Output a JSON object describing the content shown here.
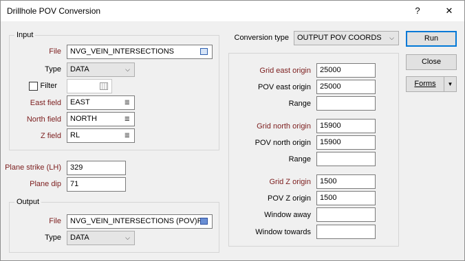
{
  "window": {
    "title": "Drillhole POV Conversion",
    "help_glyph": "?",
    "close_glyph": "✕"
  },
  "input": {
    "group_title": "Input",
    "file_label": "File",
    "file_value": "NVG_VEIN_INTERSECTIONS",
    "type_label": "Type",
    "type_value": "DATA",
    "filter_label": "Filter",
    "filter_value": "",
    "east_label": "East field",
    "east_value": "EAST",
    "north_label": "North field",
    "north_value": "NORTH",
    "z_label": "Z field",
    "z_value": "RL"
  },
  "plane": {
    "strike_label": "Plane strike (LH)",
    "strike_value": "329",
    "dip_label": "Plane dip",
    "dip_value": "71"
  },
  "output": {
    "group_title": "Output",
    "file_label": "File",
    "file_value": "NVG_VEIN_INTERSECTIONS (POV)P",
    "type_label": "Type",
    "type_value": "DATA"
  },
  "conversion": {
    "label": "Conversion type",
    "value": "OUTPUT POV COORDS",
    "grid_east_label": "Grid east origin",
    "grid_east_value": "25000",
    "pov_east_label": "POV east origin",
    "pov_east_value": "25000",
    "range1_label": "Range",
    "range1_value": "",
    "grid_north_label": "Grid north origin",
    "grid_north_value": "15900",
    "pov_north_label": "POV north origin",
    "pov_north_value": "15900",
    "range2_label": "Range",
    "range2_value": "",
    "grid_z_label": "Grid Z origin",
    "grid_z_value": "1500",
    "pov_z_label": "POV Z origin",
    "pov_z_value": "1500",
    "window_away_label": "Window away",
    "window_away_value": "",
    "window_towards_label": "Window towards",
    "window_towards_value": ""
  },
  "buttons": {
    "run": "Run",
    "close": "Close",
    "forms": "Forms",
    "forms_arrow": "▼"
  },
  "glyphs": {
    "dropdown": "⌵",
    "field_list": "≣"
  },
  "colors": {
    "required_label": "#7b1c1c",
    "default_button_border": "#0078d7"
  }
}
